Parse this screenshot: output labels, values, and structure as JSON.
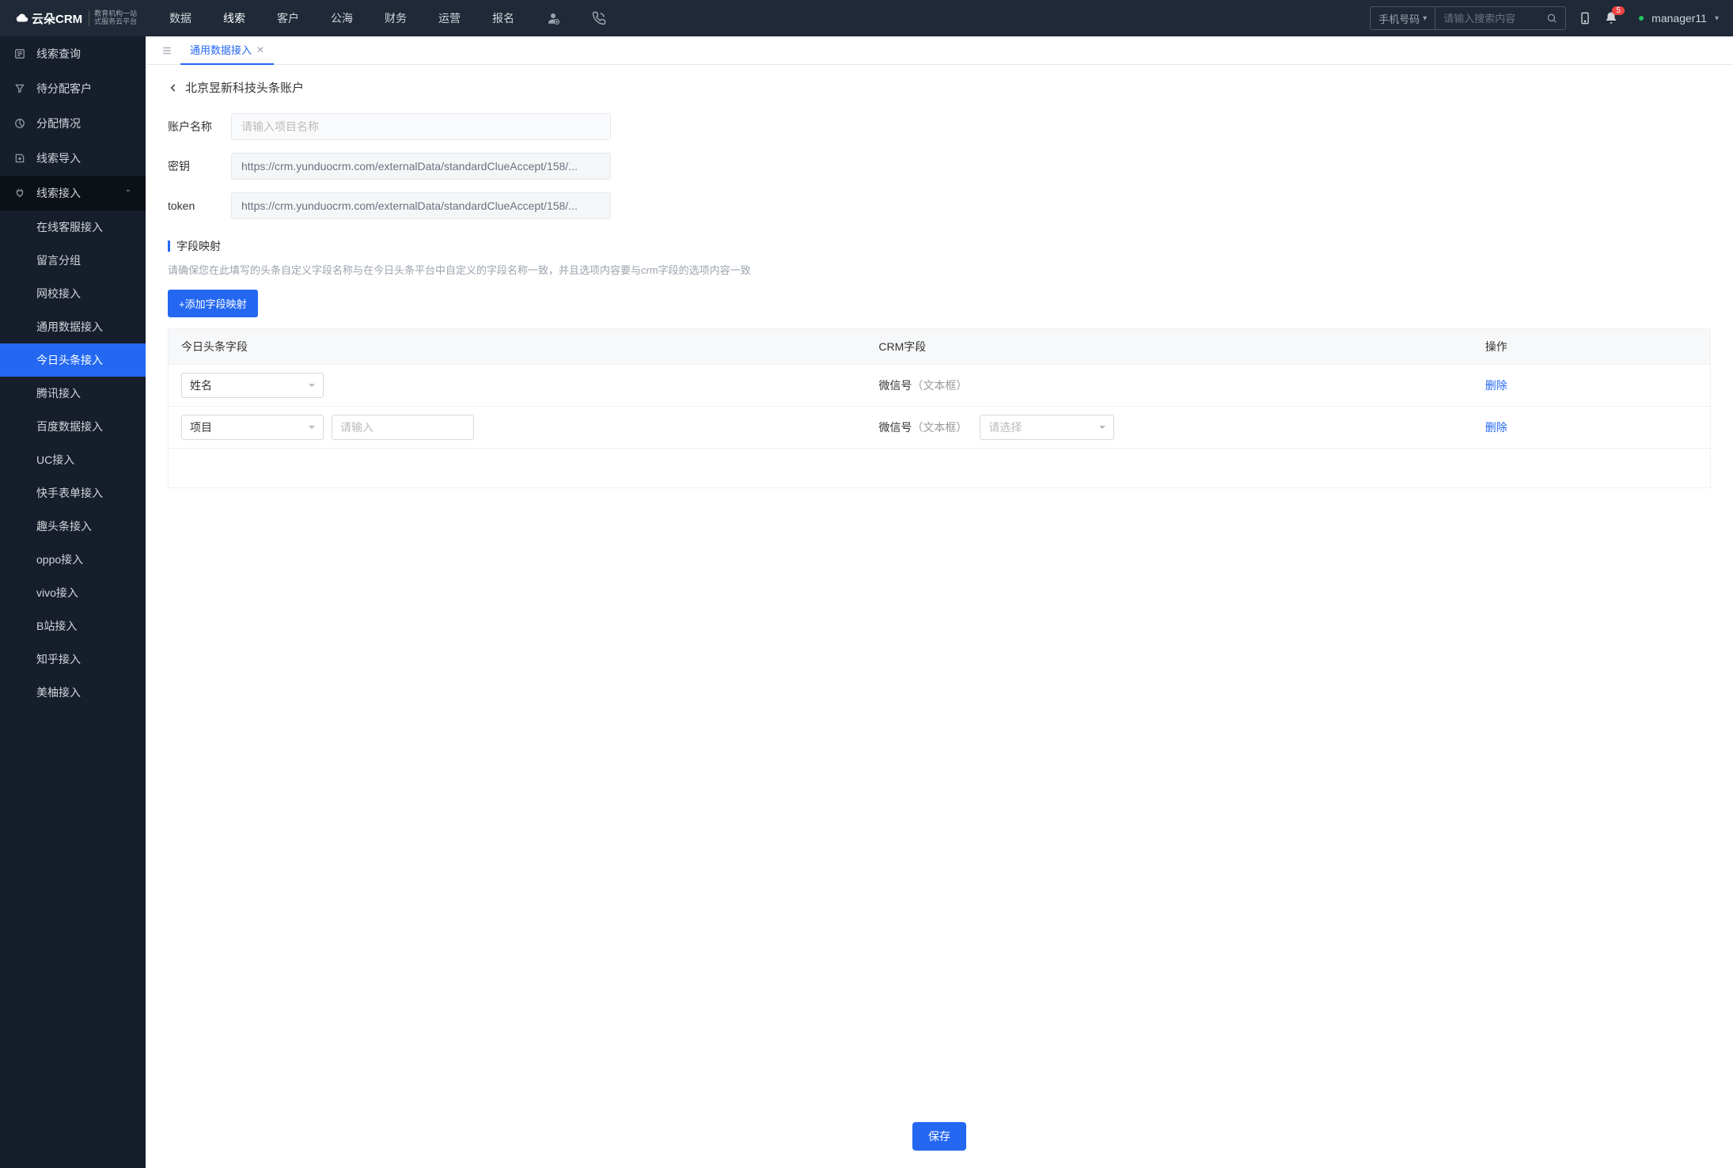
{
  "logo": {
    "name": "云朵CRM",
    "sub_line1": "教育机构一站",
    "sub_line2": "式服务云平台"
  },
  "top_nav": {
    "items": [
      "数据",
      "线索",
      "客户",
      "公海",
      "财务",
      "运营",
      "报名"
    ],
    "active_index": 1
  },
  "search": {
    "type_label": "手机号码",
    "placeholder": "请输入搜索内容"
  },
  "notifications": {
    "count": "5"
  },
  "user": {
    "name": "manager11"
  },
  "sidebar": {
    "items": [
      {
        "icon": "query",
        "label": "线索查询"
      },
      {
        "icon": "filter",
        "label": "待分配客户"
      },
      {
        "icon": "pie",
        "label": "分配情况"
      },
      {
        "icon": "import",
        "label": "线索导入"
      },
      {
        "icon": "plug",
        "label": "线索接入",
        "expanded": true,
        "children": [
          "在线客服接入",
          "留言分组",
          "网校接入",
          "通用数据接入",
          "今日头条接入",
          "腾讯接入",
          "百度数据接入",
          "UC接入",
          "快手表单接入",
          "趣头条接入",
          "oppo接入",
          "vivo接入",
          "B站接入",
          "知乎接入",
          "美柚接入"
        ],
        "active_child_index": 4
      }
    ]
  },
  "tabs": {
    "active": {
      "label": "通用数据接入"
    }
  },
  "page": {
    "title": "北京昱新科技头条账户",
    "form": {
      "name_label": "账户名称",
      "name_placeholder": "请输入项目名称",
      "secret_label": "密钥",
      "secret_value": "https://crm.yunduocrm.com/externalData/standardClueAccept/158/...",
      "token_label": "token",
      "token_value": "https://crm.yunduocrm.com/externalData/standardClueAccept/158/..."
    },
    "mapping": {
      "section_title": "字段映射",
      "section_desc": "请确保您在此填写的头条自定义字段名称与在今日头条平台中自定义的字段名称一致，并且选项内容要与crm字段的选项内容一致",
      "add_btn": "+添加字段映射",
      "columns": {
        "toutiao": "今日头条字段",
        "crm": "CRM字段",
        "op": "操作"
      },
      "rows": [
        {
          "toutiao_select": "姓名",
          "crm_field_name": "微信号",
          "crm_field_type": "（文本框）",
          "delete": "删除"
        },
        {
          "toutiao_select": "项目",
          "extra_input_placeholder": "请输入",
          "crm_field_name": "微信号",
          "crm_field_type": "（文本框）",
          "crm_select_placeholder": "请选择",
          "delete": "删除"
        }
      ]
    },
    "save_btn": "保存"
  }
}
